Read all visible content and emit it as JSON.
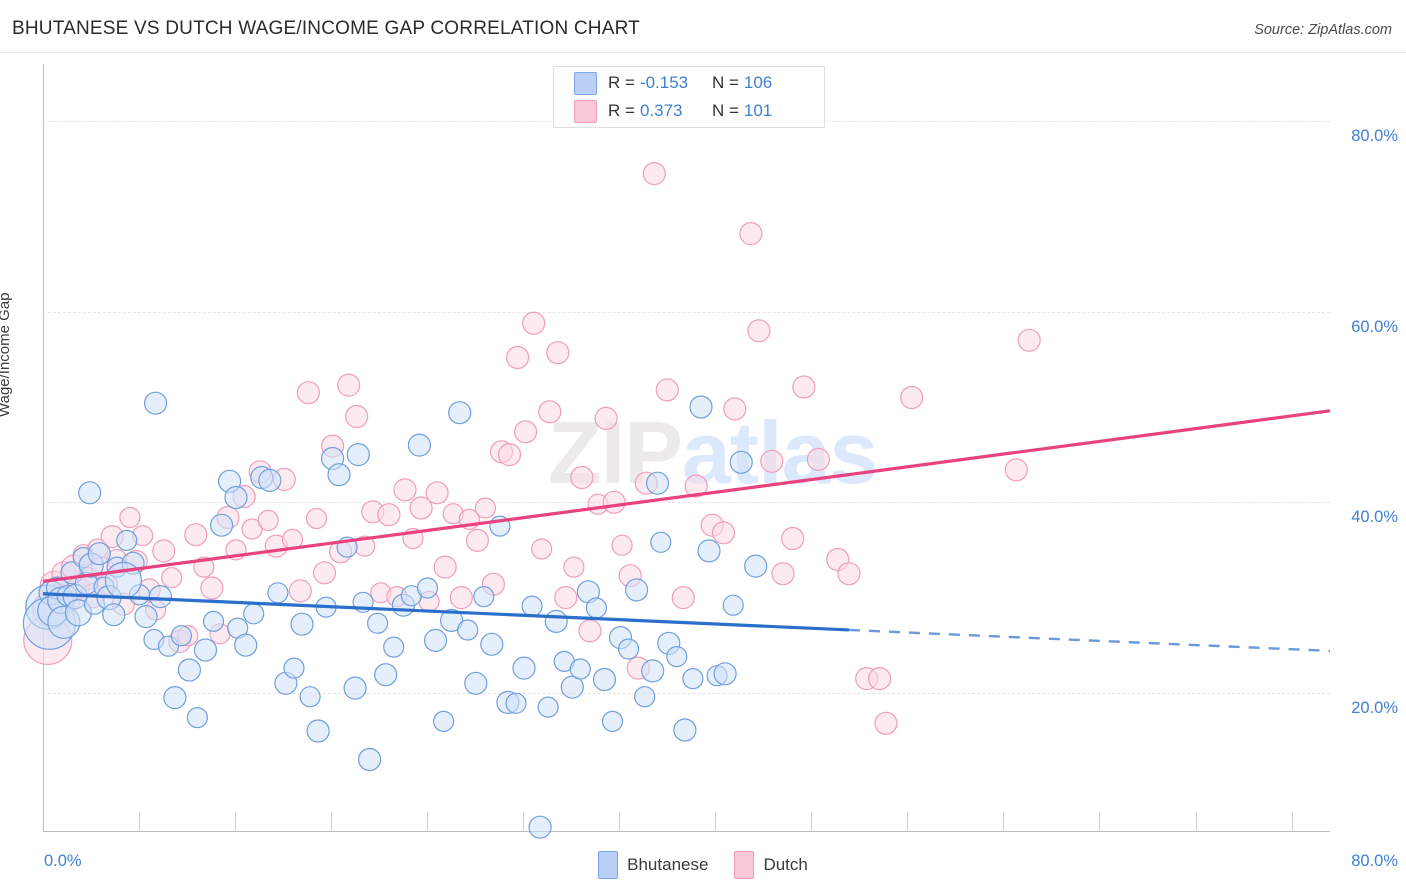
{
  "header": {
    "title": "BHUTANESE VS DUTCH WAGE/INCOME GAP CORRELATION CHART",
    "source": "Source: ZipAtlas.com"
  },
  "watermark": {
    "part1": "ZIP",
    "part2": "atlas"
  },
  "stats": {
    "rows": [
      {
        "series": "Bhutanese",
        "r_label": "R =",
        "r_value": "-0.153",
        "n_label": "N =",
        "n_value": "106",
        "color": "#b9d0f4"
      },
      {
        "series": "Dutch",
        "r_label": "R =",
        "r_value": "0.373",
        "n_label": "N =",
        "n_value": "101",
        "color": "#f9c9d9"
      }
    ]
  },
  "legend": {
    "items": [
      {
        "label": "Bhutanese",
        "color": "#b9d0f4"
      },
      {
        "label": "Dutch",
        "color": "#f9c9d9"
      }
    ]
  },
  "axes": {
    "y_label": "Wage/Income Gap",
    "y_ticks": [
      "80.0%",
      "60.0%",
      "40.0%",
      "20.0%"
    ],
    "x_min_label": "0.0%",
    "x_max_label": "80.0%"
  },
  "chart_data": {
    "type": "scatter",
    "title": "BHUTANESE VS DUTCH WAGE/INCOME GAP CORRELATION CHART",
    "xlabel": "",
    "ylabel": "Wage/Income Gap",
    "xlim": [
      0,
      80
    ],
    "ylim": [
      5.5,
      86
    ],
    "x_unit": "%",
    "y_unit": "%",
    "grid": true,
    "y_gridlines": [
      20,
      40,
      60,
      80
    ],
    "legend_position": "bottom-center",
    "colors": {
      "bhutanese_fill": "#cfe0f8",
      "bhutanese_stroke": "#6f9fdd",
      "dutch_fill": "#fbd9e4",
      "dutch_stroke": "#ef9dba",
      "bhutanese_line": "#2a6fc9",
      "dutch_line": "#e8437f",
      "tick_text": "#3f7fd4"
    },
    "series": [
      {
        "name": "Bhutanese",
        "r": -0.153,
        "n": 106,
        "trend": {
          "x0": 0,
          "y0": 30.4,
          "x1": 50.1,
          "y1": 26.6,
          "x_dash_start": 50.1,
          "x_dash_end": 80,
          "y_dash_end": 24.4
        },
        "points": [
          [
            0.3,
            29.0,
            22
          ],
          [
            0.4,
            27.3,
            26
          ],
          [
            0.5,
            30.5,
            12
          ],
          [
            0.6,
            28.6,
            15
          ],
          [
            0.9,
            31.0,
            11
          ],
          [
            1.1,
            29.7,
            13
          ],
          [
            1.3,
            27.4,
            16
          ],
          [
            1.5,
            30.2,
            10
          ],
          [
            1.8,
            32.6,
            11
          ],
          [
            2.0,
            30.1,
            12
          ],
          [
            2.2,
            28.4,
            13
          ],
          [
            2.5,
            34.2,
            10
          ],
          [
            2.7,
            31.5,
            11
          ],
          [
            3.0,
            33.4,
            12
          ],
          [
            3.2,
            29.3,
            10
          ],
          [
            3.5,
            34.6,
            11
          ],
          [
            3.8,
            31.1,
            10
          ],
          [
            4.1,
            30.0,
            12
          ],
          [
            4.4,
            28.2,
            11
          ],
          [
            4.6,
            33.2,
            10
          ],
          [
            2.9,
            41.0,
            11
          ],
          [
            5.2,
            36.0,
            10
          ],
          [
            5.6,
            33.6,
            11
          ],
          [
            6.0,
            30.3,
            10
          ],
          [
            6.4,
            28.0,
            11
          ],
          [
            6.9,
            25.6,
            10
          ],
          [
            7.3,
            30.1,
            11
          ],
          [
            7.8,
            24.9,
            10
          ],
          [
            8.2,
            19.5,
            11
          ],
          [
            8.6,
            26.0,
            10
          ],
          [
            7.0,
            50.4,
            11
          ],
          [
            9.1,
            22.4,
            11
          ],
          [
            9.6,
            17.4,
            10
          ],
          [
            10.1,
            24.5,
            11
          ],
          [
            10.6,
            27.5,
            10
          ],
          [
            11.1,
            37.6,
            11
          ],
          [
            11.6,
            42.2,
            11
          ],
          [
            12.1,
            26.8,
            10
          ],
          [
            12.6,
            25.0,
            11
          ],
          [
            13.1,
            28.3,
            10
          ],
          [
            13.6,
            42.6,
            11
          ],
          [
            14.1,
            42.3,
            11
          ],
          [
            14.6,
            30.5,
            10
          ],
          [
            15.1,
            21.0,
            11
          ],
          [
            15.6,
            22.6,
            10
          ],
          [
            16.1,
            27.2,
            11
          ],
          [
            16.6,
            19.6,
            10
          ],
          [
            17.1,
            16.0,
            11
          ],
          [
            17.6,
            29.0,
            10
          ],
          [
            18.0,
            44.6,
            11
          ],
          [
            18.4,
            42.9,
            11
          ],
          [
            18.9,
            35.3,
            10
          ],
          [
            19.4,
            20.5,
            11
          ],
          [
            19.9,
            29.5,
            10
          ],
          [
            20.3,
            13.0,
            11
          ],
          [
            20.8,
            27.3,
            10
          ],
          [
            21.3,
            21.9,
            11
          ],
          [
            21.8,
            24.8,
            10
          ],
          [
            22.4,
            29.2,
            11
          ],
          [
            22.9,
            30.2,
            10
          ],
          [
            23.4,
            46.0,
            11
          ],
          [
            23.9,
            31.0,
            10
          ],
          [
            24.4,
            25.5,
            11
          ],
          [
            24.9,
            17.0,
            10
          ],
          [
            25.4,
            27.6,
            11
          ],
          [
            25.9,
            49.4,
            11
          ],
          [
            26.4,
            26.6,
            10
          ],
          [
            26.9,
            21.0,
            11
          ],
          [
            27.4,
            30.1,
            10
          ],
          [
            27.9,
            25.1,
            11
          ],
          [
            28.4,
            37.5,
            10
          ],
          [
            28.9,
            19.0,
            11
          ],
          [
            29.4,
            18.9,
            10
          ],
          [
            29.9,
            22.6,
            11
          ],
          [
            30.4,
            29.1,
            10
          ],
          [
            30.9,
            5.9,
            11
          ],
          [
            31.4,
            18.5,
            10
          ],
          [
            31.9,
            27.5,
            11
          ],
          [
            32.4,
            23.3,
            10
          ],
          [
            32.9,
            20.6,
            11
          ],
          [
            33.4,
            22.5,
            10
          ],
          [
            33.9,
            30.6,
            11
          ],
          [
            34.4,
            28.9,
            10
          ],
          [
            34.9,
            21.4,
            11
          ],
          [
            35.4,
            17.0,
            10
          ],
          [
            35.9,
            25.8,
            11
          ],
          [
            36.4,
            24.6,
            10
          ],
          [
            36.9,
            30.8,
            11
          ],
          [
            37.4,
            19.6,
            10
          ],
          [
            37.9,
            22.3,
            11
          ],
          [
            38.4,
            35.8,
            10
          ],
          [
            38.9,
            25.2,
            11
          ],
          [
            39.4,
            23.8,
            10
          ],
          [
            39.9,
            16.1,
            11
          ],
          [
            40.4,
            21.5,
            10
          ],
          [
            40.9,
            50.0,
            11
          ],
          [
            41.4,
            34.9,
            11
          ],
          [
            41.9,
            21.8,
            10
          ],
          [
            42.4,
            22.0,
            11
          ],
          [
            42.9,
            29.2,
            10
          ],
          [
            43.4,
            44.2,
            11
          ],
          [
            44.3,
            33.3,
            11
          ],
          [
            38.2,
            42.0,
            11
          ],
          [
            19.6,
            45.0,
            11
          ],
          [
            12.0,
            40.5,
            11
          ],
          [
            5.0,
            31.8,
            18
          ]
        ]
      },
      {
        "name": "Dutch",
        "r": 0.373,
        "n": 101,
        "trend": {
          "x0": 0,
          "y0": 31.7,
          "x1": 80,
          "y1": 49.6
        },
        "points": [
          [
            0.3,
            25.5,
            24
          ],
          [
            0.5,
            28.8,
            18
          ],
          [
            0.7,
            31.3,
            14
          ],
          [
            1.0,
            30.1,
            13
          ],
          [
            1.3,
            32.5,
            12
          ],
          [
            1.6,
            29.6,
            11
          ],
          [
            1.9,
            33.2,
            12
          ],
          [
            2.2,
            31.0,
            11
          ],
          [
            2.5,
            34.5,
            10
          ],
          [
            2.8,
            32.0,
            11
          ],
          [
            3.1,
            30.2,
            12
          ],
          [
            3.4,
            35.1,
            10
          ],
          [
            3.7,
            33.1,
            11
          ],
          [
            4.0,
            31.4,
            10
          ],
          [
            4.3,
            36.4,
            11
          ],
          [
            4.6,
            34.0,
            10
          ],
          [
            5.0,
            29.3,
            11
          ],
          [
            5.4,
            38.4,
            10
          ],
          [
            5.8,
            33.8,
            11
          ],
          [
            6.2,
            36.5,
            10
          ],
          [
            6.6,
            30.8,
            11
          ],
          [
            7.0,
            28.7,
            10
          ],
          [
            7.5,
            34.9,
            11
          ],
          [
            8.0,
            32.1,
            10
          ],
          [
            8.5,
            25.4,
            11
          ],
          [
            9.0,
            26.0,
            10
          ],
          [
            9.5,
            36.6,
            11
          ],
          [
            10.0,
            33.2,
            10
          ],
          [
            10.5,
            31.0,
            11
          ],
          [
            11.0,
            26.2,
            10
          ],
          [
            11.5,
            38.4,
            11
          ],
          [
            12.0,
            35.0,
            10
          ],
          [
            12.5,
            40.6,
            11
          ],
          [
            13.0,
            37.2,
            10
          ],
          [
            13.5,
            43.2,
            11
          ],
          [
            14.0,
            38.1,
            10
          ],
          [
            14.5,
            35.4,
            11
          ],
          [
            15.0,
            42.4,
            11
          ],
          [
            15.5,
            36.1,
            10
          ],
          [
            16.0,
            30.7,
            11
          ],
          [
            16.5,
            51.5,
            11
          ],
          [
            17.0,
            38.3,
            10
          ],
          [
            17.5,
            32.6,
            11
          ],
          [
            18.0,
            45.9,
            11
          ],
          [
            18.5,
            34.8,
            11
          ],
          [
            19.0,
            52.3,
            11
          ],
          [
            19.5,
            49.0,
            11
          ],
          [
            20.0,
            35.4,
            10
          ],
          [
            20.5,
            39.0,
            11
          ],
          [
            21.0,
            30.5,
            10
          ],
          [
            21.5,
            38.7,
            11
          ],
          [
            22.0,
            30.1,
            10
          ],
          [
            22.5,
            41.3,
            11
          ],
          [
            23.0,
            36.2,
            10
          ],
          [
            23.5,
            39.4,
            11
          ],
          [
            24.0,
            29.6,
            10
          ],
          [
            24.5,
            41.0,
            11
          ],
          [
            25.0,
            33.2,
            11
          ],
          [
            25.5,
            38.8,
            10
          ],
          [
            26.0,
            30.0,
            11
          ],
          [
            26.5,
            38.2,
            10
          ],
          [
            27.0,
            36.0,
            11
          ],
          [
            27.5,
            39.4,
            10
          ],
          [
            28.0,
            31.4,
            11
          ],
          [
            28.5,
            45.3,
            11
          ],
          [
            29.0,
            45.0,
            11
          ],
          [
            29.5,
            55.2,
            11
          ],
          [
            30.0,
            47.4,
            11
          ],
          [
            30.5,
            58.8,
            11
          ],
          [
            31.0,
            35.1,
            10
          ],
          [
            31.5,
            49.5,
            11
          ],
          [
            32.0,
            55.7,
            11
          ],
          [
            32.5,
            30.0,
            11
          ],
          [
            33.0,
            33.2,
            10
          ],
          [
            33.5,
            42.6,
            11
          ],
          [
            34.0,
            26.5,
            11
          ],
          [
            34.5,
            39.8,
            10
          ],
          [
            35.0,
            48.8,
            11
          ],
          [
            35.5,
            40.0,
            11
          ],
          [
            36.0,
            35.5,
            10
          ],
          [
            36.5,
            32.3,
            11
          ],
          [
            37.0,
            22.6,
            11
          ],
          [
            37.5,
            42.0,
            11
          ],
          [
            38.0,
            74.5,
            11
          ],
          [
            38.8,
            51.8,
            11
          ],
          [
            39.8,
            30.0,
            11
          ],
          [
            40.6,
            41.7,
            11
          ],
          [
            41.6,
            37.6,
            11
          ],
          [
            42.3,
            36.8,
            11
          ],
          [
            43.0,
            49.8,
            11
          ],
          [
            44.0,
            68.2,
            11
          ],
          [
            44.5,
            58.0,
            11
          ],
          [
            45.3,
            44.3,
            11
          ],
          [
            46.0,
            32.5,
            11
          ],
          [
            46.6,
            36.2,
            11
          ],
          [
            47.3,
            52.1,
            11
          ],
          [
            48.2,
            44.5,
            11
          ],
          [
            49.4,
            34.0,
            11
          ],
          [
            50.1,
            32.5,
            11
          ],
          [
            51.2,
            21.5,
            11
          ],
          [
            52.0,
            21.5,
            11
          ],
          [
            52.4,
            16.8,
            11
          ],
          [
            54.0,
            51.0,
            11
          ],
          [
            60.5,
            43.4,
            11
          ],
          [
            61.3,
            57.0,
            11
          ]
        ]
      }
    ]
  }
}
